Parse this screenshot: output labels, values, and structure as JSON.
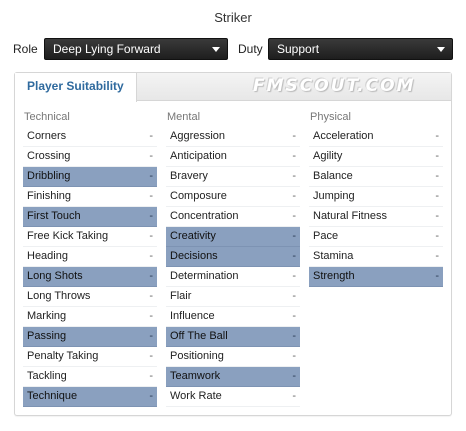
{
  "title": "Striker",
  "role": {
    "label": "Role",
    "value": "Deep Lying Forward"
  },
  "duty": {
    "label": "Duty",
    "value": "Support"
  },
  "panel": {
    "tab": "Player Suitability",
    "watermark": "FMSCOUT.COM"
  },
  "highlight_color": "#8aa0bf",
  "columns": [
    {
      "heading": "Technical",
      "rows": [
        {
          "name": "Corners",
          "value": "-",
          "key": false
        },
        {
          "name": "Crossing",
          "value": "-",
          "key": false
        },
        {
          "name": "Dribbling",
          "value": "-",
          "key": true
        },
        {
          "name": "Finishing",
          "value": "-",
          "key": false
        },
        {
          "name": "First Touch",
          "value": "-",
          "key": true
        },
        {
          "name": "Free Kick Taking",
          "value": "-",
          "key": false
        },
        {
          "name": "Heading",
          "value": "-",
          "key": false
        },
        {
          "name": "Long Shots",
          "value": "-",
          "key": true
        },
        {
          "name": "Long Throws",
          "value": "-",
          "key": false
        },
        {
          "name": "Marking",
          "value": "-",
          "key": false
        },
        {
          "name": "Passing",
          "value": "-",
          "key": true
        },
        {
          "name": "Penalty Taking",
          "value": "-",
          "key": false
        },
        {
          "name": "Tackling",
          "value": "-",
          "key": false
        },
        {
          "name": "Technique",
          "value": "-",
          "key": true
        }
      ]
    },
    {
      "heading": "Mental",
      "rows": [
        {
          "name": "Aggression",
          "value": "-",
          "key": false
        },
        {
          "name": "Anticipation",
          "value": "-",
          "key": false
        },
        {
          "name": "Bravery",
          "value": "-",
          "key": false
        },
        {
          "name": "Composure",
          "value": "-",
          "key": false
        },
        {
          "name": "Concentration",
          "value": "-",
          "key": false
        },
        {
          "name": "Creativity",
          "value": "-",
          "key": true
        },
        {
          "name": "Decisions",
          "value": "-",
          "key": true
        },
        {
          "name": "Determination",
          "value": "-",
          "key": false
        },
        {
          "name": "Flair",
          "value": "-",
          "key": false
        },
        {
          "name": "Influence",
          "value": "-",
          "key": false
        },
        {
          "name": "Off The Ball",
          "value": "-",
          "key": true
        },
        {
          "name": "Positioning",
          "value": "-",
          "key": false
        },
        {
          "name": "Teamwork",
          "value": "-",
          "key": true
        },
        {
          "name": "Work Rate",
          "value": "-",
          "key": false
        }
      ]
    },
    {
      "heading": "Physical",
      "rows": [
        {
          "name": "Acceleration",
          "value": "-",
          "key": false
        },
        {
          "name": "Agility",
          "value": "-",
          "key": false
        },
        {
          "name": "Balance",
          "value": "-",
          "key": false
        },
        {
          "name": "Jumping",
          "value": "-",
          "key": false
        },
        {
          "name": "Natural Fitness",
          "value": "-",
          "key": false
        },
        {
          "name": "Pace",
          "value": "-",
          "key": false
        },
        {
          "name": "Stamina",
          "value": "-",
          "key": false
        },
        {
          "name": "Strength",
          "value": "-",
          "key": true
        }
      ]
    }
  ]
}
